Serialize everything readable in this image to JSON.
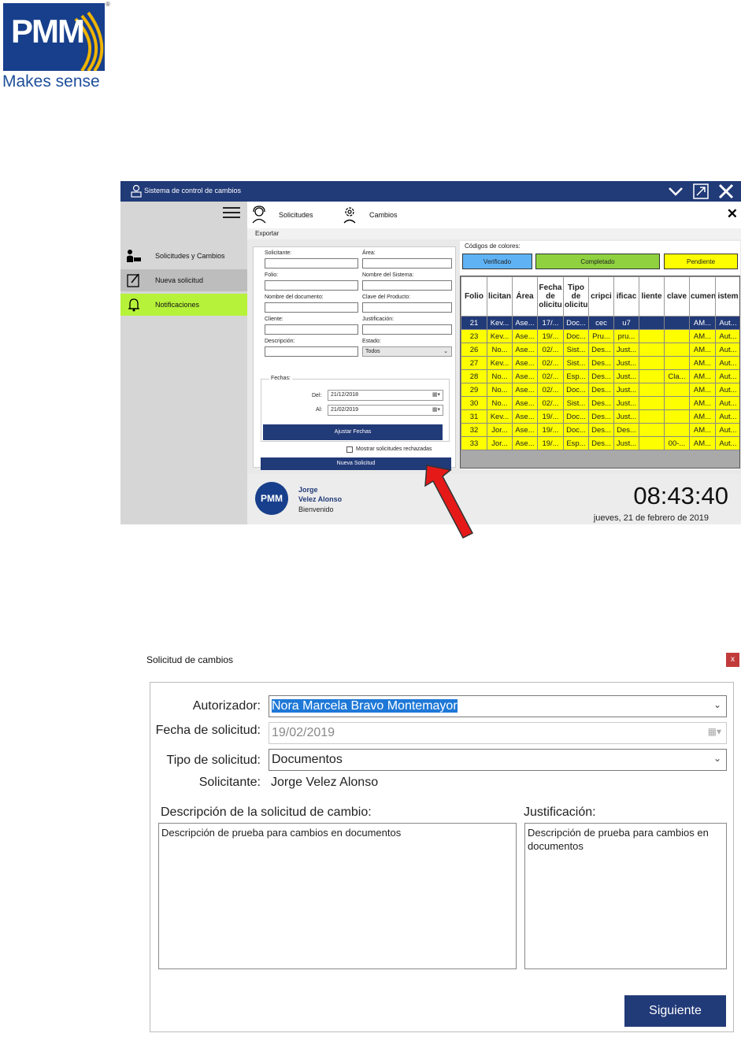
{
  "logo": {
    "wordmark": "PMM",
    "tagline": "Makes sense",
    "registered": "®",
    "brand_color": "#173f8c",
    "accent_color": "#f0b400"
  },
  "app": {
    "title": "Sistema de control de cambios",
    "controls": [
      "chevron-down-icon",
      "maximize-icon",
      "close-icon"
    ],
    "sidebar": {
      "items": [
        {
          "label": "Solicitudes y Cambios",
          "icon": "person-laptop-icon"
        },
        {
          "label": "Nueva solicitud",
          "icon": "edit-document-icon"
        },
        {
          "label": "Notificaciones",
          "icon": "bell-icon"
        }
      ]
    },
    "nav": {
      "items": [
        {
          "label": "Solicitudes",
          "icon": "support-agent-icon"
        },
        {
          "label": "Cambios",
          "icon": "gear-person-icon"
        }
      ],
      "close": "✕"
    },
    "export": "Exportar",
    "filters": {
      "solicitante": "Solicitante:",
      "area": "Área:",
      "folio": "Folio:",
      "nombre_sistema": "Nombre del Sistema:",
      "nombre_documento": "Nombre del documento:",
      "clave_producto": "Clave del Producto:",
      "cliente": "Cliente:",
      "justificacion": "Justificación:",
      "descripcion": "Descripción:",
      "estado": "Estado:",
      "estado_value": "Todos",
      "fechas": "Fechas:",
      "del": "Del:",
      "del_value": "21/12/2018",
      "al": "Al:",
      "al_value": "21/02/2019",
      "ajustar": "Ajustar Fechas",
      "mostrar": "Mostrar solicitudes rechazadas",
      "nueva": "Nueva Solicitud"
    },
    "colors": {
      "title": "Códigos de colores:",
      "verificado": "Verificado",
      "completado": "Completado",
      "pendiente": "Pendiente",
      "verificado_color": "#5fb3f5",
      "completado_color": "#8fd13f",
      "pendiente_color": "#fdff00"
    },
    "grid": {
      "headers": [
        "Folio",
        "licitan",
        "Área",
        "Fecha de olicitu",
        "Tipo de olicitu",
        "cripci",
        "ificac",
        "liente",
        "clave",
        "cumen",
        "istem"
      ],
      "rows": [
        [
          "21",
          "Kev...",
          "Ase...",
          "17/...",
          "Doc...",
          "cec",
          "u7",
          "",
          "",
          "AM...",
          "Aut..."
        ],
        [
          "23",
          "Kev...",
          "Ase...",
          "19/...",
          "Doc...",
          "Pru...",
          "pru...",
          "",
          "",
          "AM...",
          "Aut..."
        ],
        [
          "26",
          "No...",
          "Ase...",
          "02/...",
          "Sist...",
          "Des...",
          "Just...",
          "",
          "",
          "AM...",
          "Aut..."
        ],
        [
          "27",
          "Kev...",
          "Ase...",
          "02/...",
          "Sist...",
          "Des...",
          "Just...",
          "",
          "",
          "AM...",
          "Aut..."
        ],
        [
          "28",
          "No...",
          "Ase...",
          "02/...",
          "Esp...",
          "Des...",
          "Just...",
          "",
          "Cla...",
          "AM...",
          "Aut..."
        ],
        [
          "29",
          "No...",
          "Ase...",
          "02/...",
          "Doc...",
          "Des...",
          "Just...",
          "",
          "",
          "AM...",
          "Aut..."
        ],
        [
          "30",
          "No...",
          "Ase...",
          "02/...",
          "Sist...",
          "Des...",
          "Just...",
          "",
          "",
          "AM...",
          "Aut..."
        ],
        [
          "31",
          "Kev...",
          "Ase...",
          "19/...",
          "Doc...",
          "Des...",
          "Just...",
          "",
          "",
          "AM...",
          "Aut..."
        ],
        [
          "32",
          "Jor...",
          "Ase...",
          "19/...",
          "Doc...",
          "Des...",
          "Des...",
          "",
          "",
          "AM...",
          "Aut..."
        ],
        [
          "33",
          "Jor...",
          "Ase...",
          "19/...",
          "Esp...",
          "Des...",
          "Just...",
          "",
          "00-...",
          "AM...",
          "Aut..."
        ]
      ]
    },
    "user": {
      "avatar": "PMM",
      "first": "Jorge",
      "last": "Velez Alonso",
      "welcome": "Bienvenido"
    },
    "clock": "08:43:40",
    "date": "jueves, 21 de febrero de 2019"
  },
  "dialog": {
    "title": "Solicitud de cambios",
    "close": "x",
    "autorizador_label": "Autorizador:",
    "autorizador_value": "Nora Marcela Bravo Montemayor",
    "fecha_label": "Fecha de solicitud:",
    "fecha_value": "19/02/2019",
    "tipo_label": "Tipo de solicitud:",
    "tipo_value": "Documentos",
    "solicitante_label": "Solicitante:",
    "solicitante_value": "Jorge Velez Alonso",
    "descripcion_label": "Descripción de la solicitud de cambio:",
    "descripcion_value": "Descripción de prueba para cambios en documentos",
    "justificacion_label": "Justificación:",
    "justificacion_value": "Descripción de prueba para cambios en documentos",
    "next": "Siguiente"
  }
}
